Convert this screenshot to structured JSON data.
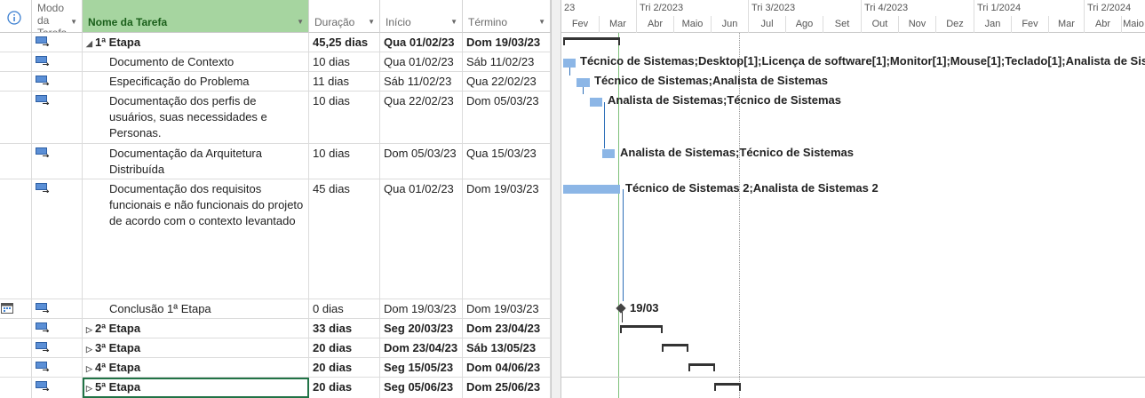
{
  "columns": {
    "info_icon": "info-icon",
    "mode": "Modo da Tarefa",
    "name": "Nome da Tarefa",
    "duration": "Duração",
    "start": "Início",
    "finish": "Término"
  },
  "tasks": [
    {
      "name": "1ª Etapa",
      "duration": "45,25 dias",
      "start": "Qua 01/02/23",
      "finish": "Dom 19/03/23",
      "summary": true,
      "expanded": true
    },
    {
      "name": "Documento de Contexto",
      "duration": "10 dias",
      "start": "Qua 01/02/23",
      "finish": "Sáb 11/02/23"
    },
    {
      "name": "Especificação do Problema",
      "duration": "11 dias",
      "start": "Sáb 11/02/23",
      "finish": "Qua 22/02/23"
    },
    {
      "name": "Documentação dos perfis de usuários, suas necessidades e Personas.",
      "duration": "10 dias",
      "start": "Qua 22/02/23",
      "finish": "Dom 05/03/23"
    },
    {
      "name": "Documentação da Arquitetura Distribuída",
      "duration": "10 dias",
      "start": "Dom 05/03/23",
      "finish": "Qua 15/03/23"
    },
    {
      "name": "Documentação dos requisitos funcionais e não funcionais do projeto de acordo com o contexto levantado",
      "duration": "45 dias",
      "start": "Qua 01/02/23",
      "finish": "Dom 19/03/23"
    },
    {
      "name": "Conclusão 1ª Etapa",
      "duration": "0 dias",
      "start": "Dom 19/03/23",
      "finish": "Dom 19/03/23"
    },
    {
      "name": "2ª Etapa",
      "duration": "33 dias",
      "start": "Seg 20/03/23",
      "finish": "Dom 23/04/23",
      "summary": true
    },
    {
      "name": "3ª Etapa",
      "duration": "20 dias",
      "start": "Dom 23/04/23",
      "finish": "Sáb 13/05/23",
      "summary": true
    },
    {
      "name": "4ª Etapa",
      "duration": "20 dias",
      "start": "Seg 15/05/23",
      "finish": "Dom 04/06/23",
      "summary": true
    },
    {
      "name": "5ª Etapa",
      "duration": "20 dias",
      "start": "Seg 05/06/23",
      "finish": "Dom 25/06/23",
      "summary": true
    }
  ],
  "timeline": {
    "quarters": [
      "23",
      "Tri 2/2023",
      "Tri 3/2023",
      "Tri 4/2023",
      "Tri 1/2024",
      "Tri 2/2024"
    ],
    "months": [
      "Fev",
      "Mar",
      "Abr",
      "Maio",
      "Jun",
      "Jul",
      "Ago",
      "Set",
      "Out",
      "Nov",
      "Dez",
      "Jan",
      "Fev",
      "Mar",
      "Abr",
      "Maio"
    ]
  },
  "gantt_labels": [
    "Técnico de Sistemas;Desktop[1];Licença de software[1];Monitor[1];Mouse[1];Teclado[1];Analista de Sis",
    "Técnico de Sistemas;Analista de Sistemas",
    "Analista de Sistemas;Técnico de Sistemas",
    "Analista de Sistemas;Técnico de Sistemas",
    "Técnico de Sistemas 2;Analista de Sistemas 2",
    "19/03"
  ],
  "colors": {
    "bar": "#8cb6e6",
    "header_active": "#a6d5a0",
    "link": "#2e6fb8",
    "today_line": "#7ec07a"
  }
}
